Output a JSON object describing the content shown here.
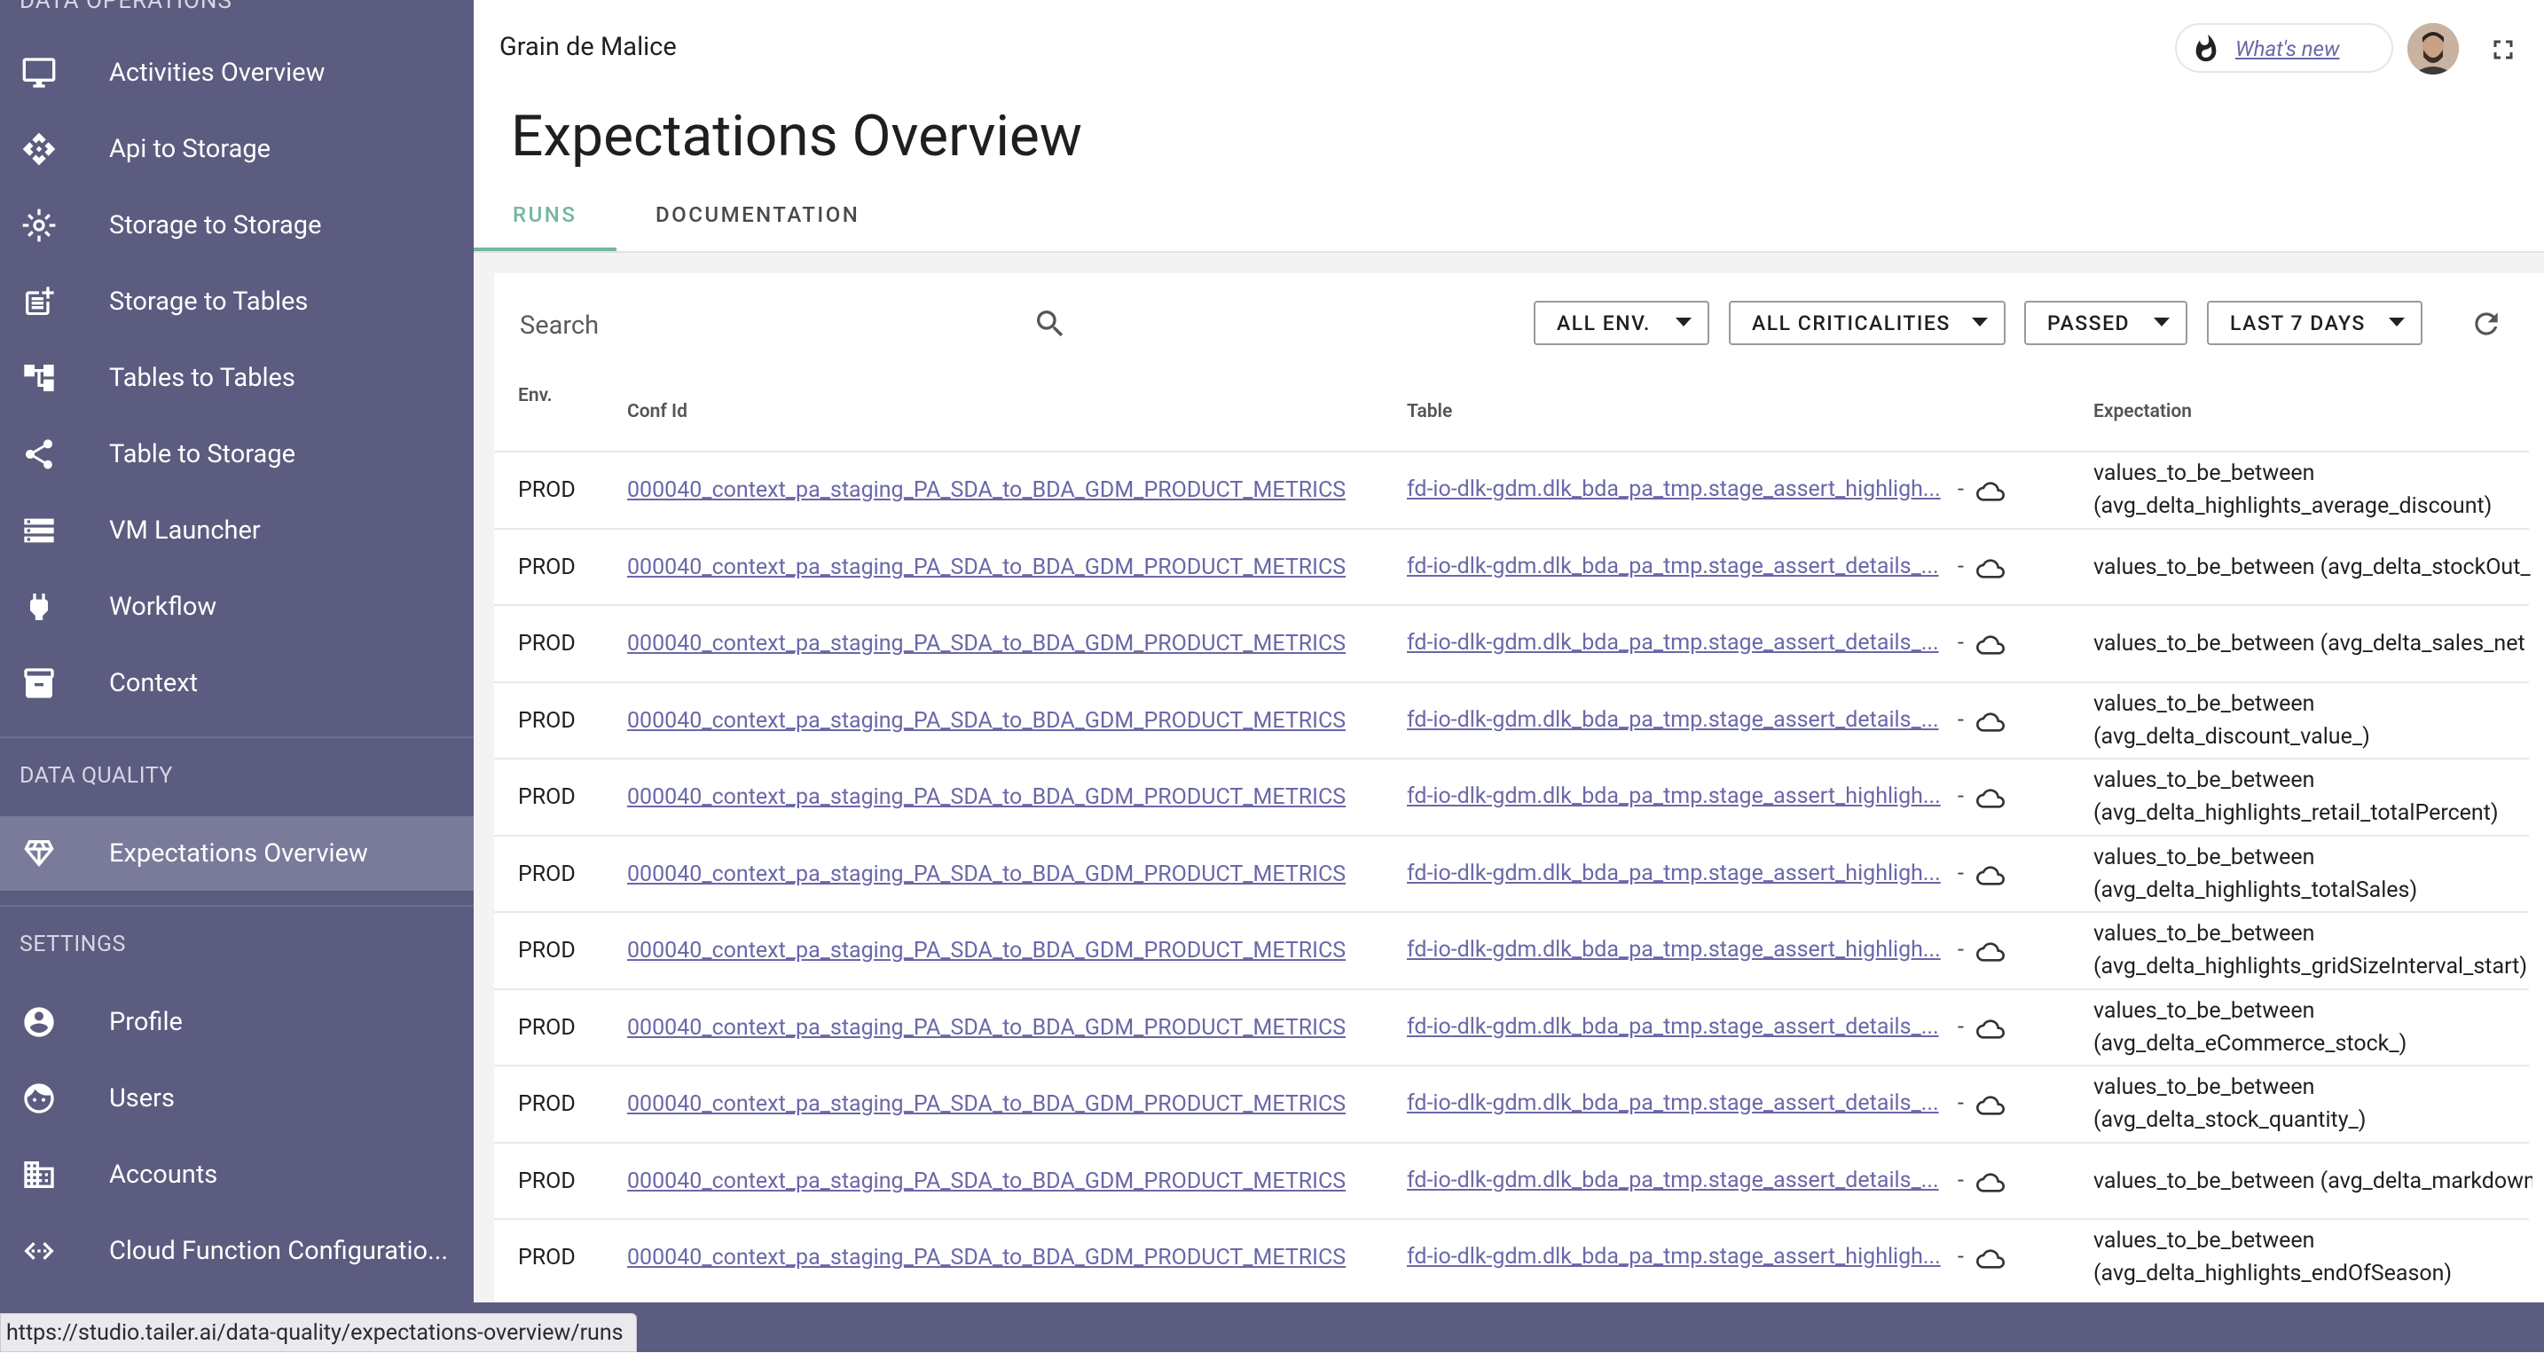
{
  "sidebar": {
    "section_cut": "DATA OPERATIONS",
    "items": [
      {
        "label": "Activities Overview",
        "icon": "monitor-icon"
      },
      {
        "label": "Api to Storage",
        "icon": "api-icon"
      },
      {
        "label": "Storage to Storage",
        "icon": "storage-transfer-icon"
      },
      {
        "label": "Storage to Tables",
        "icon": "post-add-icon"
      },
      {
        "label": "Tables to Tables",
        "icon": "account-tree-icon"
      },
      {
        "label": "Table to Storage",
        "icon": "share-icon"
      },
      {
        "label": "VM Launcher",
        "icon": "storage-dns-icon"
      },
      {
        "label": "Workflow",
        "icon": "power-plug-icon"
      },
      {
        "label": "Context",
        "icon": "archive-icon"
      }
    ],
    "data_quality_header": "DATA QUALITY",
    "dq_items": [
      {
        "label": "Expectations Overview",
        "icon": "diamond-icon",
        "active": true
      }
    ],
    "settings_header": "SETTINGS",
    "settings_items": [
      {
        "label": "Profile",
        "icon": "account-circle-icon"
      },
      {
        "label": "Users",
        "icon": "face-icon"
      },
      {
        "label": "Accounts",
        "icon": "business-icon"
      },
      {
        "label": "Cloud Function Configuratio...",
        "icon": "code-icon"
      }
    ]
  },
  "topbar": {
    "org_name": "Grain de Malice",
    "whats_new": "What's new"
  },
  "page": {
    "title": "Expectations Overview",
    "tabs": [
      {
        "label": "RUNS",
        "active": true
      },
      {
        "label": "DOCUMENTATION",
        "active": false
      }
    ]
  },
  "filters": {
    "search_placeholder": "Search",
    "env": "ALL ENV.",
    "criticality": "ALL CRITICALITIES",
    "status": "PASSED",
    "period": "LAST 7 DAYS"
  },
  "table": {
    "columns": [
      "Env.",
      "Conf Id",
      "Table",
      "Expectation"
    ],
    "rows": [
      {
        "env": "PROD",
        "conf_id": "000040_context_pa_staging_PA_SDA_to_BDA_GDM_PRODUCT_METRICS",
        "table": "fd-io-dlk-gdm.dlk_bda_pa_tmp.stage_assert_highligh...",
        "expectation": "values_to_be_between (avg_delta_highlights_average_discount)"
      },
      {
        "env": "PROD",
        "conf_id": "000040_context_pa_staging_PA_SDA_to_BDA_GDM_PRODUCT_METRICS",
        "table": "fd-io-dlk-gdm.dlk_bda_pa_tmp.stage_assert_details_...",
        "expectation": "values_to_be_between (avg_delta_stockOut_"
      },
      {
        "env": "PROD",
        "conf_id": "000040_context_pa_staging_PA_SDA_to_BDA_GDM_PRODUCT_METRICS",
        "table": "fd-io-dlk-gdm.dlk_bda_pa_tmp.stage_assert_details_...",
        "expectation": "values_to_be_between (avg_delta_sales_net"
      },
      {
        "env": "PROD",
        "conf_id": "000040_context_pa_staging_PA_SDA_to_BDA_GDM_PRODUCT_METRICS",
        "table": "fd-io-dlk-gdm.dlk_bda_pa_tmp.stage_assert_details_...",
        "expectation": "values_to_be_between (avg_delta_discount_value_)"
      },
      {
        "env": "PROD",
        "conf_id": "000040_context_pa_staging_PA_SDA_to_BDA_GDM_PRODUCT_METRICS",
        "table": "fd-io-dlk-gdm.dlk_bda_pa_tmp.stage_assert_highligh...",
        "expectation": "values_to_be_between (avg_delta_highlights_retail_totalPercent)"
      },
      {
        "env": "PROD",
        "conf_id": "000040_context_pa_staging_PA_SDA_to_BDA_GDM_PRODUCT_METRICS",
        "table": "fd-io-dlk-gdm.dlk_bda_pa_tmp.stage_assert_highligh...",
        "expectation": "values_to_be_between (avg_delta_highlights_totalSales)"
      },
      {
        "env": "PROD",
        "conf_id": "000040_context_pa_staging_PA_SDA_to_BDA_GDM_PRODUCT_METRICS",
        "table": "fd-io-dlk-gdm.dlk_bda_pa_tmp.stage_assert_highligh...",
        "expectation": "values_to_be_between (avg_delta_highlights_gridSizeInterval_start)"
      },
      {
        "env": "PROD",
        "conf_id": "000040_context_pa_staging_PA_SDA_to_BDA_GDM_PRODUCT_METRICS",
        "table": "fd-io-dlk-gdm.dlk_bda_pa_tmp.stage_assert_details_...",
        "expectation": "values_to_be_between (avg_delta_eCommerce_stock_)"
      },
      {
        "env": "PROD",
        "conf_id": "000040_context_pa_staging_PA_SDA_to_BDA_GDM_PRODUCT_METRICS",
        "table": "fd-io-dlk-gdm.dlk_bda_pa_tmp.stage_assert_details_...",
        "expectation": "values_to_be_between (avg_delta_stock_quantity_)"
      },
      {
        "env": "PROD",
        "conf_id": "000040_context_pa_staging_PA_SDA_to_BDA_GDM_PRODUCT_METRICS",
        "table": "fd-io-dlk-gdm.dlk_bda_pa_tmp.stage_assert_details_...",
        "expectation": "values_to_be_between (avg_delta_markdown"
      },
      {
        "env": "PROD",
        "conf_id": "000040_context_pa_staging_PA_SDA_to_BDA_GDM_PRODUCT_METRICS",
        "table": "fd-io-dlk-gdm.dlk_bda_pa_tmp.stage_assert_highligh...",
        "expectation": "values_to_be_between (avg_delta_highlights_endOfSeason)"
      }
    ],
    "row_separator": "-"
  },
  "statusbar": {
    "url": "https://studio.tailer.ai/data-quality/expectations-overview/runs"
  },
  "colors": {
    "sidebar_bg": "#5b5c7f",
    "sidebar_active": "#7a7b9a",
    "accent_tab": "#76b69c",
    "link": "#6a67a8"
  }
}
